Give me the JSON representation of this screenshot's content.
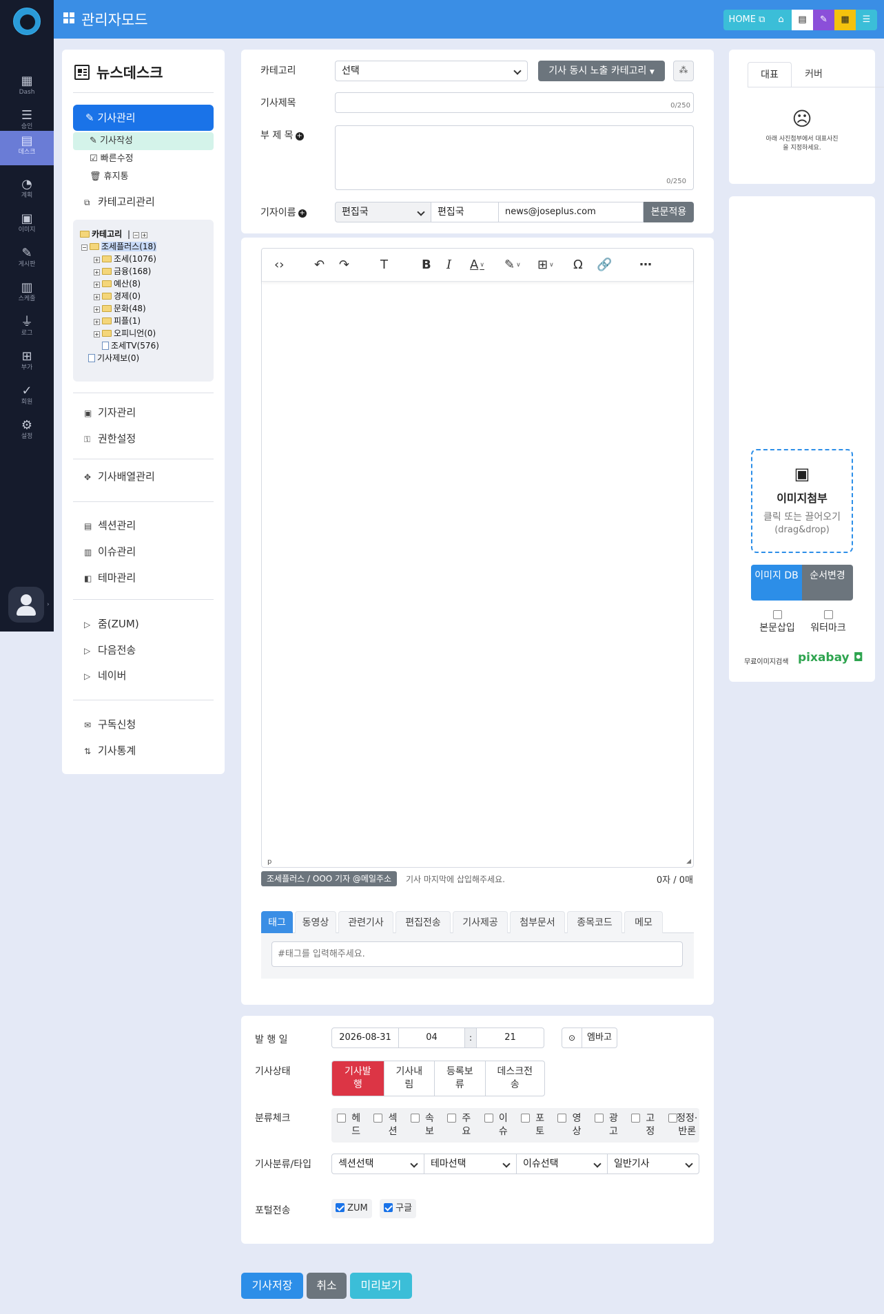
{
  "topbar": {
    "title": "관리자모드",
    "home_label": "HOME"
  },
  "rail": {
    "items": [
      "Dash",
      "승인",
      "데스크",
      "계획",
      "이미지",
      "게시판",
      "스케줄",
      "로그",
      "부가",
      "회원",
      "설정"
    ],
    "active": "데스크"
  },
  "leftnav": {
    "title": "뉴스데스크",
    "primary": "기사관리",
    "subs": [
      "기사작성",
      "빠른수정",
      "휴지통"
    ],
    "category_manage": "카테고리관리",
    "tree": {
      "root": "카테고리",
      "parent": "조세플러스(18)",
      "children": [
        "조세(1076)",
        "금융(168)",
        "예산(8)",
        "경제(0)",
        "문화(48)",
        "피플(1)",
        "오피니언(0)",
        "조세TV(576)"
      ],
      "report": "기사제보(0)"
    },
    "group1": [
      "기자관리",
      "권한설정"
    ],
    "group2": [
      "기사배열관리"
    ],
    "group3": [
      "섹션관리",
      "이슈관리",
      "테마관리"
    ],
    "group4": [
      "줌(ZUM)",
      "다음전송",
      "네이버"
    ],
    "group5": [
      "구독신청",
      "기사통계"
    ]
  },
  "form": {
    "category_label": "카테고리",
    "category_value": "선택",
    "concurrent_button": "기사 동시 노출 카테고리",
    "title_label": "기사제목",
    "title_count": "0/250",
    "subtitle_label": "부 제 목",
    "subtitle_count": "0/250",
    "reporter_label": "기자이름",
    "reporter_select": "편집국",
    "reporter_name": "편집국",
    "reporter_email": "news@joseplus.com",
    "apply_button": "본문적용"
  },
  "editor": {
    "status_tag": "p",
    "signature": "조세플러스 / OOO 기자 @메일주소",
    "signature_hint": "기사 마지막에 삽입해주세요.",
    "counter": "0자 / 0매",
    "tabs": [
      "태그",
      "동영상",
      "관련기사",
      "편집전송",
      "기사제공",
      "첨부문서",
      "종목코드",
      "메모"
    ],
    "active_tab": "태그",
    "tag_placeholder": "#태그를 입력해주세요."
  },
  "publish": {
    "date_label": "발 행 일",
    "date": "2026-08-31",
    "hour": "04",
    "minute": "21",
    "embargo": "엠바고",
    "status_label": "기사상태",
    "status_options": [
      "기사발행",
      "기사내림",
      "등록보류",
      "데스크전송"
    ],
    "status_active": "기사발행",
    "class_label": "분류체크",
    "class_options": [
      "헤드",
      "섹션",
      "속보",
      "주요",
      "이슈",
      "포토",
      "영상",
      "광고",
      "고정",
      "정정·반론"
    ],
    "type_label": "기사분류/타입",
    "type_selects": [
      "섹션선택",
      "테마선택",
      "이슈선택",
      "일반기사"
    ],
    "portal_label": "포털전송",
    "portals": [
      "ZUM",
      "구글"
    ]
  },
  "right": {
    "tabs": [
      "대표",
      "커버"
    ],
    "cover_msg": "아래 사진첨부에서 대표사진을 지정하세요.",
    "attach_title": "이미지첨부",
    "attach_hint": "클릭 또는 끌어오기",
    "attach_hint2": "(drag&drop)",
    "imgdb_btn": "이미지 DB",
    "reorder_btn": "순서변경",
    "insert_label": "본문삽입",
    "watermark_label": "워터마크",
    "free_search": "무료이미지검색",
    "pixabay": "pixabay"
  },
  "actions": {
    "save": "기사저장",
    "cancel": "취소",
    "preview": "미리보기"
  },
  "colors": {
    "primary": "#1a73e8",
    "topbar": "#3a8ee5",
    "danger": "#dc3545",
    "info": "#3bbed8",
    "secondary": "#6c757d"
  }
}
